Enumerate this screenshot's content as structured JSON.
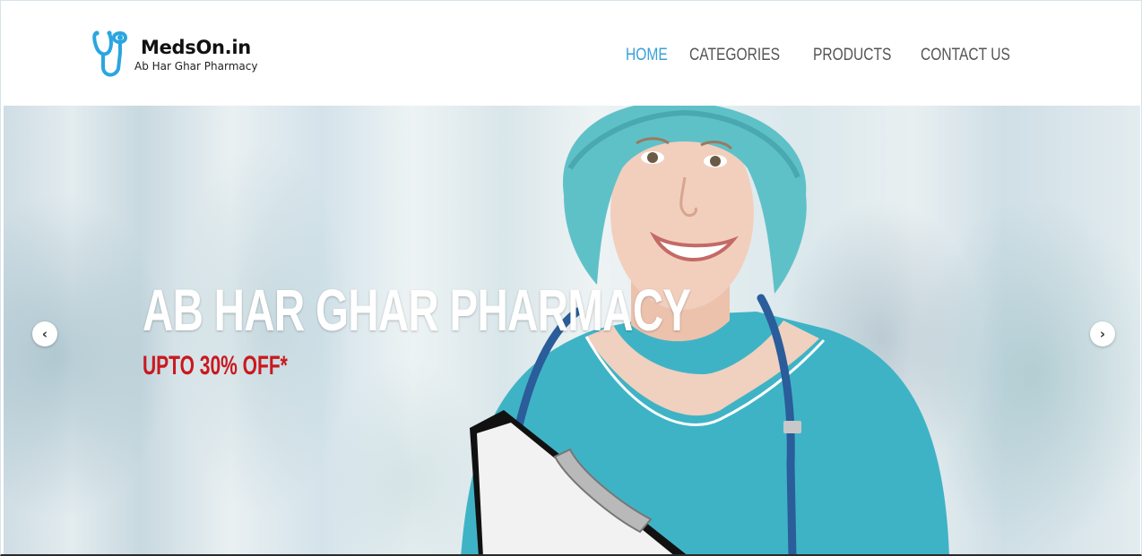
{
  "brand": {
    "name": "MedsOn.in",
    "tagline": "Ab Har Ghar Pharmacy",
    "logo_icon": "stethoscope-icon",
    "logo_color": "#2aa6df"
  },
  "nav": {
    "items": [
      {
        "label": "HOME",
        "active": true
      },
      {
        "label": "CATEGORIES",
        "active": false
      },
      {
        "label": "PRODUCTS",
        "active": false
      },
      {
        "label": "CONTACT US",
        "active": false
      }
    ],
    "active_color": "#3a9fd8",
    "color": "#555555"
  },
  "hero": {
    "title": "AB HAR GHAR PHARMACY",
    "offer": "UPTO 30% OFF*",
    "offer_color": "#c8191f",
    "prev_icon": "chevron-left-icon",
    "next_icon": "chevron-right-icon",
    "prev_glyph": "‹",
    "next_glyph": "›"
  }
}
